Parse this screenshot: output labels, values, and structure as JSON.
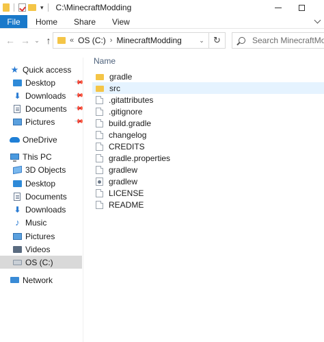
{
  "window": {
    "title": "C:\\MinecraftModding"
  },
  "ribbon": {
    "tabs": [
      "File",
      "Home",
      "Share",
      "View"
    ]
  },
  "nav": {
    "back_icon": "back-arrow-icon",
    "forward_icon": "forward-arrow-icon",
    "up_icon": "up-arrow-icon",
    "address_overflow": "«",
    "breadcrumb": [
      "OS (C:)",
      "MinecraftModding"
    ],
    "refresh_icon": "refresh-icon",
    "search_placeholder": "Search MinecraftModding"
  },
  "sidebar": {
    "items": [
      {
        "label": "Quick access",
        "icon": "star-icon"
      },
      {
        "label": "Desktop",
        "icon": "desktop-icon",
        "pinned": true
      },
      {
        "label": "Downloads",
        "icon": "downloads-icon",
        "pinned": true
      },
      {
        "label": "Documents",
        "icon": "documents-icon",
        "pinned": true
      },
      {
        "label": "Pictures",
        "icon": "pictures-icon",
        "pinned": true
      },
      {
        "label": "OneDrive",
        "icon": "onedrive-icon"
      },
      {
        "label": "This PC",
        "icon": "this-pc-icon"
      },
      {
        "label": "3D Objects",
        "icon": "3d-objects-icon"
      },
      {
        "label": "Desktop",
        "icon": "desktop-icon"
      },
      {
        "label": "Documents",
        "icon": "documents-icon"
      },
      {
        "label": "Downloads",
        "icon": "downloads-icon"
      },
      {
        "label": "Music",
        "icon": "music-icon"
      },
      {
        "label": "Pictures",
        "icon": "pictures-icon"
      },
      {
        "label": "Videos",
        "icon": "videos-icon"
      },
      {
        "label": "OS (C:)",
        "icon": "drive-icon",
        "selected": true
      },
      {
        "label": "Network",
        "icon": "network-icon"
      }
    ]
  },
  "files": {
    "column_name": "Name",
    "items": [
      {
        "name": "gradle",
        "type": "folder"
      },
      {
        "name": "src",
        "type": "folder",
        "hovered": true
      },
      {
        "name": ".gitattributes",
        "type": "file"
      },
      {
        "name": ".gitignore",
        "type": "file"
      },
      {
        "name": "build.gradle",
        "type": "file"
      },
      {
        "name": "changelog",
        "type": "file"
      },
      {
        "name": "CREDITS",
        "type": "file"
      },
      {
        "name": "gradle.properties",
        "type": "file"
      },
      {
        "name": "gradlew",
        "type": "file"
      },
      {
        "name": "gradlew",
        "type": "batch"
      },
      {
        "name": "LICENSE",
        "type": "file"
      },
      {
        "name": "README",
        "type": "file"
      }
    ]
  },
  "colors": {
    "file_tab": "#1979ca",
    "hover_row": "#e5f3ff",
    "selected_nav": "#d9d9d9",
    "folder": "#f4c547",
    "column_header": "#4c607a"
  }
}
